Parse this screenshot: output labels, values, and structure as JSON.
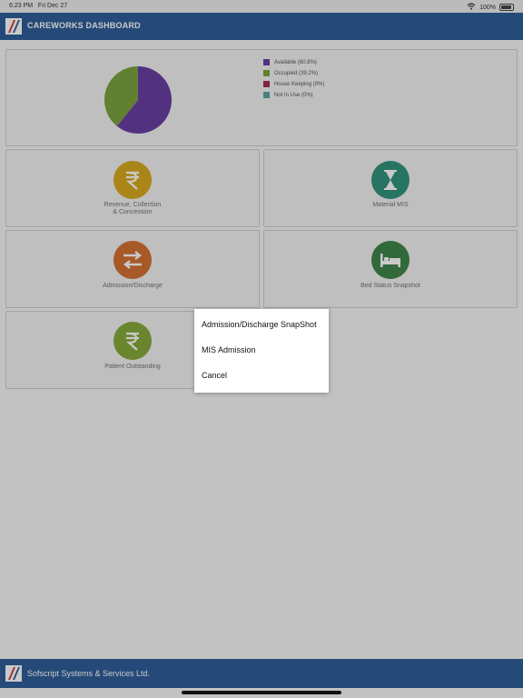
{
  "status_bar": {
    "time": "6:23 PM",
    "date": "Fri Dec 27",
    "battery": "100%"
  },
  "header": {
    "title": "CAREWORKS DASHBOARD"
  },
  "bed_chart": {
    "legend": [
      {
        "label": "Available (60.8%)",
        "color": "#5b2d9b"
      },
      {
        "label": "Occupied (39.2%)",
        "color": "#6f9a2e"
      },
      {
        "label": "House Keeping (0%)",
        "color": "#9e1b45"
      },
      {
        "label": "Not In Use (0%)",
        "color": "#4a9c9a"
      }
    ]
  },
  "chart_data": {
    "type": "pie",
    "categories": [
      "Available (60.8%)",
      "Occupied (39.2%)",
      "House Keeping (0%)",
      "Not In Use (0%)"
    ],
    "values": [
      60.8,
      39.2,
      0,
      0
    ],
    "colors": [
      "#5b2d9b",
      "#6f9a2e",
      "#9e1b45",
      "#4a9c9a"
    ],
    "legend_position": "right"
  },
  "tiles": {
    "revenue": {
      "label_line1": "Revenue, Collection",
      "label_line2": "& Concession",
      "icon": "rupee-icon",
      "color": "#d4a20a"
    },
    "material": {
      "label": "Material MIS",
      "icon": "hourglass-icon",
      "color": "#1f8a72"
    },
    "admission": {
      "label": "Admission/Discharge",
      "icon": "transfer-icon",
      "color": "#d0641f"
    },
    "bed_status": {
      "label": "Bed Status Snapshot",
      "icon": "bed-icon",
      "color": "#2f7a3a"
    },
    "outstanding": {
      "label": "Patient Outstanding",
      "icon": "rupee-icon",
      "color": "#7aa22a"
    }
  },
  "action_menu": {
    "items": [
      "Admission/Discharge SnapShot",
      "MIS Admission",
      "Cancel"
    ]
  },
  "footer": {
    "company": "Sofscript Systems & Services Ltd."
  }
}
